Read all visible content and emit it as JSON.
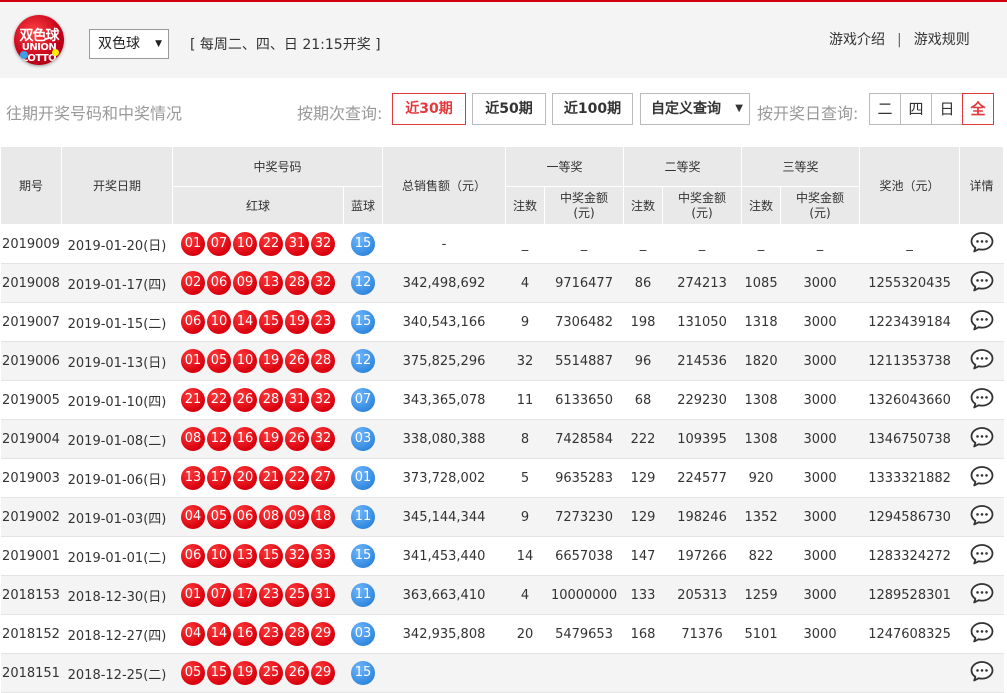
{
  "header": {
    "logo_text_1": "双色球",
    "logo_text_2": "UNION LOTTO",
    "game_select_value": "双色球",
    "schedule": "[ 每周二、四、日 21:15开奖 ]",
    "links": [
      "游戏介绍",
      "游戏规则"
    ],
    "link_sep": "|"
  },
  "toolbar": {
    "title": "往期开奖号码和中奖情况",
    "period_query_label": "按期次查询:",
    "period_buttons": [
      "近30期",
      "近50期",
      "近100期"
    ],
    "active_period": "近30期",
    "custom_query": "自定义查询",
    "date_query_label": "按开奖日查询:",
    "day_buttons": [
      "二",
      "四",
      "日",
      "全"
    ],
    "active_day": "全"
  },
  "table": {
    "headers": {
      "issue": "期号",
      "date": "开奖日期",
      "winning_numbers": "中奖号码",
      "red": "红球",
      "blue": "蓝球",
      "total_sales": "总销售额（元）",
      "prize1": "一等奖",
      "prize2": "二等奖",
      "prize3": "三等奖",
      "count": "注数",
      "amount_line1": "中奖金额",
      "amount_line2": "(元)",
      "pool": "奖池（元）",
      "detail": "详情"
    },
    "rows": [
      {
        "issue": "2019009",
        "date": "2019-01-20(日)",
        "red": [
          "01",
          "07",
          "10",
          "22",
          "31",
          "32"
        ],
        "blue": "15",
        "sales": "-",
        "p1n": "_",
        "p1a": "_",
        "p2n": "_",
        "p2a": "_",
        "p3n": "_",
        "p3a": "_",
        "pool": "_"
      },
      {
        "issue": "2019008",
        "date": "2019-01-17(四)",
        "red": [
          "02",
          "06",
          "09",
          "13",
          "28",
          "32"
        ],
        "blue": "12",
        "sales": "342,498,692",
        "p1n": "4",
        "p1a": "9716477",
        "p2n": "86",
        "p2a": "274213",
        "p3n": "1085",
        "p3a": "3000",
        "pool": "1255320435"
      },
      {
        "issue": "2019007",
        "date": "2019-01-15(二)",
        "red": [
          "06",
          "10",
          "14",
          "15",
          "19",
          "23"
        ],
        "blue": "15",
        "sales": "340,543,166",
        "p1n": "9",
        "p1a": "7306482",
        "p2n": "198",
        "p2a": "131050",
        "p3n": "1318",
        "p3a": "3000",
        "pool": "1223439184"
      },
      {
        "issue": "2019006",
        "date": "2019-01-13(日)",
        "red": [
          "01",
          "05",
          "10",
          "19",
          "26",
          "28"
        ],
        "blue": "12",
        "sales": "375,825,296",
        "p1n": "32",
        "p1a": "5514887",
        "p2n": "96",
        "p2a": "214536",
        "p3n": "1820",
        "p3a": "3000",
        "pool": "1211353738"
      },
      {
        "issue": "2019005",
        "date": "2019-01-10(四)",
        "red": [
          "21",
          "22",
          "26",
          "28",
          "31",
          "32"
        ],
        "blue": "07",
        "sales": "343,365,078",
        "p1n": "11",
        "p1a": "6133650",
        "p2n": "68",
        "p2a": "229230",
        "p3n": "1308",
        "p3a": "3000",
        "pool": "1326043660"
      },
      {
        "issue": "2019004",
        "date": "2019-01-08(二)",
        "red": [
          "08",
          "12",
          "16",
          "19",
          "26",
          "32"
        ],
        "blue": "03",
        "sales": "338,080,388",
        "p1n": "8",
        "p1a": "7428584",
        "p2n": "222",
        "p2a": "109395",
        "p3n": "1308",
        "p3a": "3000",
        "pool": "1346750738"
      },
      {
        "issue": "2019003",
        "date": "2019-01-06(日)",
        "red": [
          "13",
          "17",
          "20",
          "21",
          "22",
          "27"
        ],
        "blue": "01",
        "sales": "373,728,002",
        "p1n": "5",
        "p1a": "9635283",
        "p2n": "129",
        "p2a": "224577",
        "p3n": "920",
        "p3a": "3000",
        "pool": "1333321882"
      },
      {
        "issue": "2019002",
        "date": "2019-01-03(四)",
        "red": [
          "04",
          "05",
          "06",
          "08",
          "09",
          "18"
        ],
        "blue": "11",
        "sales": "345,144,344",
        "p1n": "9",
        "p1a": "7273230",
        "p2n": "129",
        "p2a": "198246",
        "p3n": "1352",
        "p3a": "3000",
        "pool": "1294586730"
      },
      {
        "issue": "2019001",
        "date": "2019-01-01(二)",
        "red": [
          "06",
          "10",
          "13",
          "15",
          "32",
          "33"
        ],
        "blue": "15",
        "sales": "341,453,440",
        "p1n": "14",
        "p1a": "6657038",
        "p2n": "147",
        "p2a": "197266",
        "p3n": "822",
        "p3a": "3000",
        "pool": "1283324272"
      },
      {
        "issue": "2018153",
        "date": "2018-12-30(日)",
        "red": [
          "01",
          "07",
          "17",
          "23",
          "25",
          "31"
        ],
        "blue": "11",
        "sales": "363,663,410",
        "p1n": "4",
        "p1a": "10000000",
        "p2n": "133",
        "p2a": "205313",
        "p3n": "1259",
        "p3a": "3000",
        "pool": "1289528301"
      },
      {
        "issue": "2018152",
        "date": "2018-12-27(四)",
        "red": [
          "04",
          "14",
          "16",
          "23",
          "28",
          "29"
        ],
        "blue": "03",
        "sales": "342,935,808",
        "p1n": "20",
        "p1a": "5479653",
        "p2n": "168",
        "p2a": "71376",
        "p3n": "5101",
        "p3a": "3000",
        "pool": "1247608325"
      },
      {
        "issue": "2018151",
        "date": "2018-12-25(二)",
        "red": [
          "05",
          "15",
          "19",
          "25",
          "26",
          "29"
        ],
        "blue": "15",
        "sales": "",
        "p1n": "",
        "p1a": "",
        "p2n": "",
        "p2a": "",
        "p3n": "",
        "p3a": "",
        "pool": ""
      }
    ]
  },
  "colors": {
    "accent_red": "#d2000f",
    "red_ball": "#d8000e",
    "blue_ball": "#2e86dc",
    "header_gray": "#e9e9e9"
  },
  "icons": {
    "detail": "chat-bubble-icon",
    "logo": "union-lotto-logo"
  }
}
